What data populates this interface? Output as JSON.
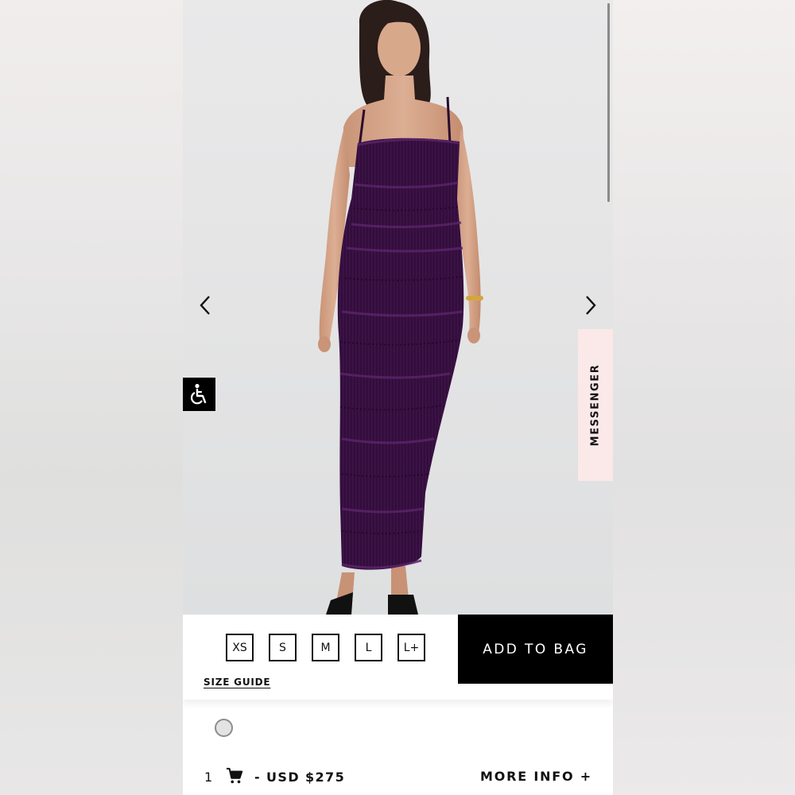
{
  "product": {
    "image_alt": "Model wearing purple tiered ruffle maxi dress",
    "dress_color": "#3c1246"
  },
  "gallery": {
    "prev_icon": "chevron-left-icon",
    "next_icon": "chevron-right-icon"
  },
  "accessibility": {
    "icon": "wheelchair-icon"
  },
  "messenger": {
    "label": "MESSENGER"
  },
  "sizes": [
    "XS",
    "S",
    "M",
    "L",
    "L+"
  ],
  "size_guide": {
    "label": "SIZE GUIDE"
  },
  "add_to_bag": {
    "label": "ADD TO BAG"
  },
  "swatch": {
    "color": "#e5e2e2"
  },
  "footer": {
    "quantity": "1",
    "cart_icon": "cart-icon",
    "price": "- USD $275",
    "more_info": "MORE INFO +"
  }
}
